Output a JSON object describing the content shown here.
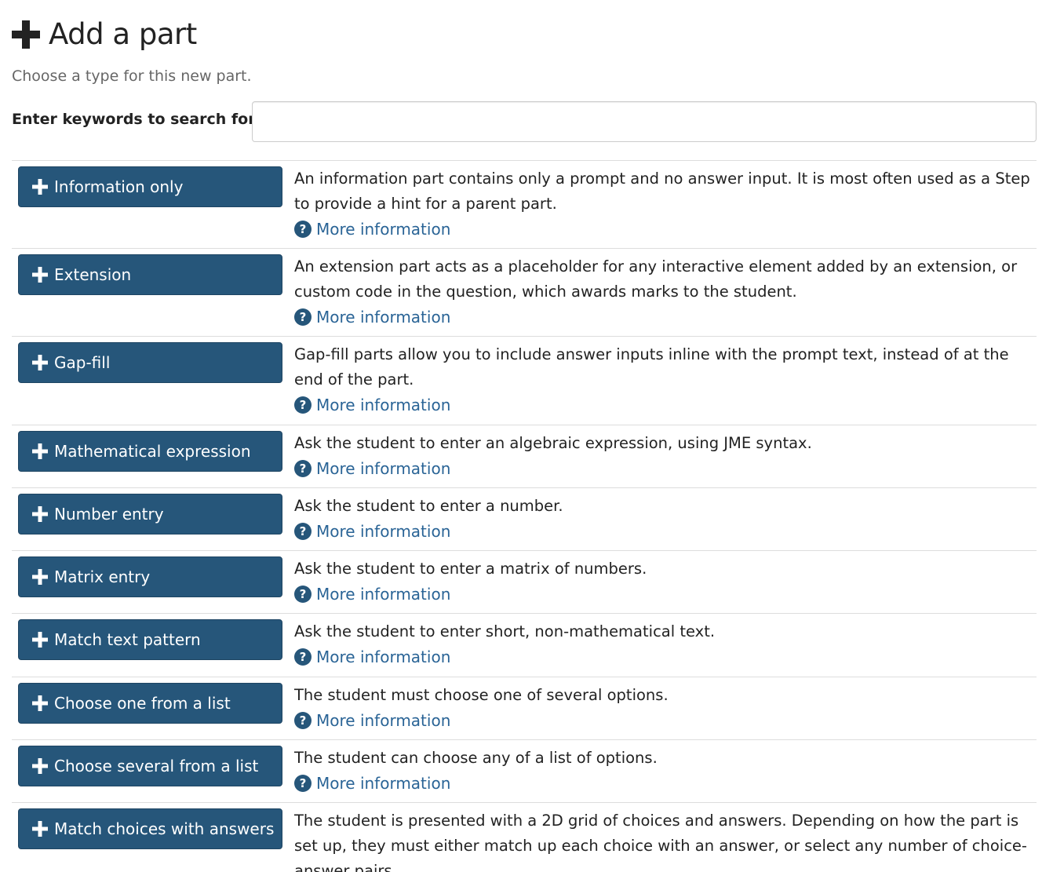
{
  "header": {
    "title": "Add a part",
    "icon": "plus-icon"
  },
  "subtitle": "Choose a type for this new part.",
  "search": {
    "label": "Enter keywords to search for",
    "value": "",
    "placeholder": ""
  },
  "colors": {
    "button": "#26567a",
    "link": "#2a6496"
  },
  "more_label": "More information",
  "parts": [
    {
      "label": "Information only",
      "desc": "An information part contains only a prompt and no answer input. It is most often used as a Step to provide a hint for a parent part."
    },
    {
      "label": "Extension",
      "desc": "An extension part acts as a placeholder for any interactive element added by an extension, or custom code in the question, which awards marks to the student."
    },
    {
      "label": "Gap-fill",
      "desc": "Gap-fill parts allow you to include answer inputs inline with the prompt text, instead of at the end of the part."
    },
    {
      "label": "Mathematical expression",
      "desc": "Ask the student to enter an algebraic expression, using JME syntax."
    },
    {
      "label": "Number entry",
      "desc": "Ask the student to enter a number."
    },
    {
      "label": "Matrix entry",
      "desc": "Ask the student to enter a matrix of numbers."
    },
    {
      "label": "Match text pattern",
      "desc": "Ask the student to enter short, non-mathematical text."
    },
    {
      "label": "Choose one from a list",
      "desc": "The student must choose one of several options."
    },
    {
      "label": "Choose several from a list",
      "desc": "The student can choose any of a list of options."
    },
    {
      "label": "Match choices with answers",
      "desc": "The student is presented with a 2D grid of choices and answers. Depending on how the part is set up, they must either match up each choice with an answer, or select any number of choice-answer pairs."
    }
  ]
}
